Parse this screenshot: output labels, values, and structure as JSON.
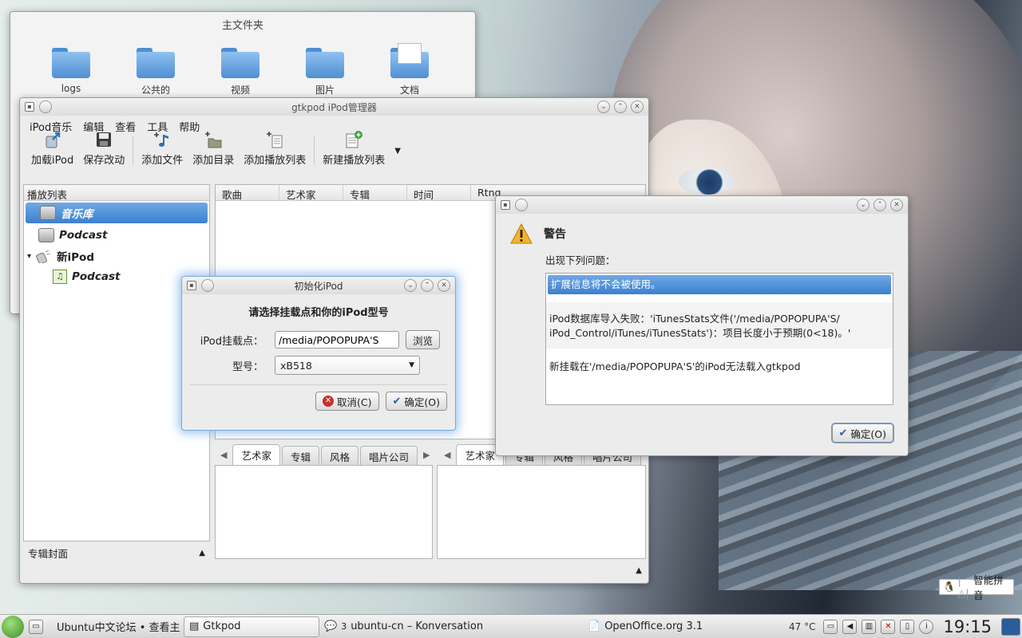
{
  "file_manager": {
    "title": "主文件夹",
    "items": [
      "logs",
      "公共的",
      "视频",
      "图片",
      "文档"
    ]
  },
  "gtkpod": {
    "title": "gtkpod iPod管理器",
    "menu": [
      "iPod音乐",
      "编辑",
      "查看",
      "工具",
      "帮助"
    ],
    "toolbar": [
      "加载iPod",
      "保存改动",
      "添加文件",
      "添加目录",
      "添加播放列表",
      "新建播放列表"
    ],
    "playlist_header": "播放列表",
    "playlists": [
      "音乐库",
      "Podcast",
      "新iPod",
      "Podcast"
    ],
    "cover_label": "专辑封面",
    "columns": [
      "歌曲",
      "艺术家",
      "专辑",
      "时间",
      "Rtng"
    ],
    "filter_tabs_left": [
      "艺术家",
      "专辑",
      "风格",
      "唱片公司"
    ],
    "filter_tabs_right": [
      "艺术家",
      "专辑",
      "风格",
      "唱片公司"
    ]
  },
  "init_dialog": {
    "title": "初始化iPod",
    "heading": "请选择挂载点和你的iPod型号",
    "mount_label": "iPod挂载点：",
    "mount_value": "/media/POPOPUPA'S",
    "browse": "浏览",
    "model_label": "型号：",
    "model_value": "xB518",
    "cancel": "取消(C)",
    "ok": "确定(O)"
  },
  "warning_dialog": {
    "title": "警告",
    "subtitle": "出现下列问题：",
    "messages": [
      "扩展信息将不会被使用。",
      "iPod数据库导入失败：'iTunesStats文件('/media/POPOPUPA'S/",
      "iPod_Control/iTunes/iTunesStats')：项目长度小于预期(0<18)。'",
      "新挂载在'/media/POPOPUPA'S'的iPod无法载入gtkpod"
    ],
    "ok": "确定(O)"
  },
  "ime": {
    "label": "智能拼音"
  },
  "taskbar": {
    "tasks": [
      "Ubuntu中文论坛 • 查看主",
      "Gtkpod",
      "ubuntu-cn – Konversation",
      "OpenOffice.org 3.1"
    ],
    "badge": "3",
    "temperature": "47 °C",
    "clock": "19:15"
  }
}
